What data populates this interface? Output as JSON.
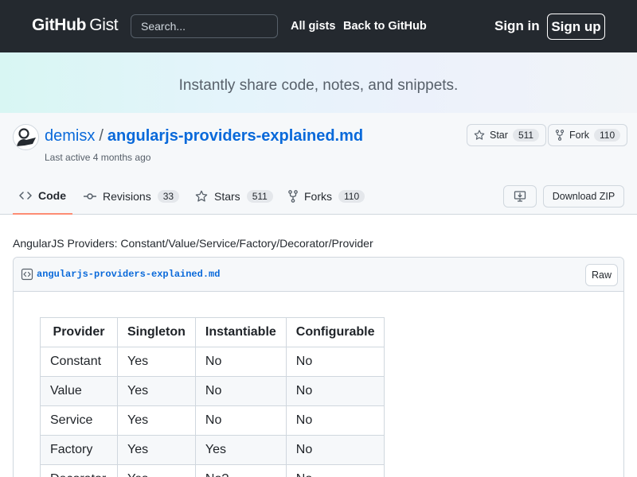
{
  "header": {
    "logo_github": "GitHub",
    "logo_gist": "Gist",
    "search_placeholder": "Search...",
    "nav": [
      "All gists",
      "Back to GitHub"
    ],
    "sign_in": "Sign in",
    "sign_up": "Sign up"
  },
  "banner": {
    "text": "Instantly share code, notes, and snippets."
  },
  "gist": {
    "owner": "demisx",
    "separator": "/",
    "filename": "angularjs-providers-explained.md",
    "last_active": "Last active 4 months ago",
    "star_label": "Star",
    "star_count": "511",
    "fork_label": "Fork",
    "fork_count": "110",
    "download_label": "Download ZIP",
    "description": "AngularJS Providers: Constant/Value/Service/Factory/Decorator/Provider"
  },
  "tabs": [
    {
      "label": "Code",
      "count": "",
      "icon": "code-icon"
    },
    {
      "label": "Revisions",
      "count": "33",
      "icon": "git-commit-icon"
    },
    {
      "label": "Stars",
      "count": "511",
      "icon": "star-icon"
    },
    {
      "label": "Forks",
      "count": "110",
      "icon": "repo-forked-icon"
    }
  ],
  "file": {
    "name": "angularjs-providers-explained.md",
    "raw_label": "Raw",
    "table": {
      "headers": [
        "Provider",
        "Singleton",
        "Instantiable",
        "Configurable"
      ],
      "rows": [
        [
          "Constant",
          "Yes",
          "No",
          "No"
        ],
        [
          "Value",
          "Yes",
          "No",
          "No"
        ],
        [
          "Service",
          "Yes",
          "No",
          "No"
        ],
        [
          "Factory",
          "Yes",
          "Yes",
          "No"
        ],
        [
          "Decorator",
          "Yes",
          "No?",
          "No"
        ]
      ]
    }
  },
  "colors": {
    "header_bg": "#24292f",
    "link": "#0969da",
    "active_tab_underline": "#fd8c73"
  }
}
